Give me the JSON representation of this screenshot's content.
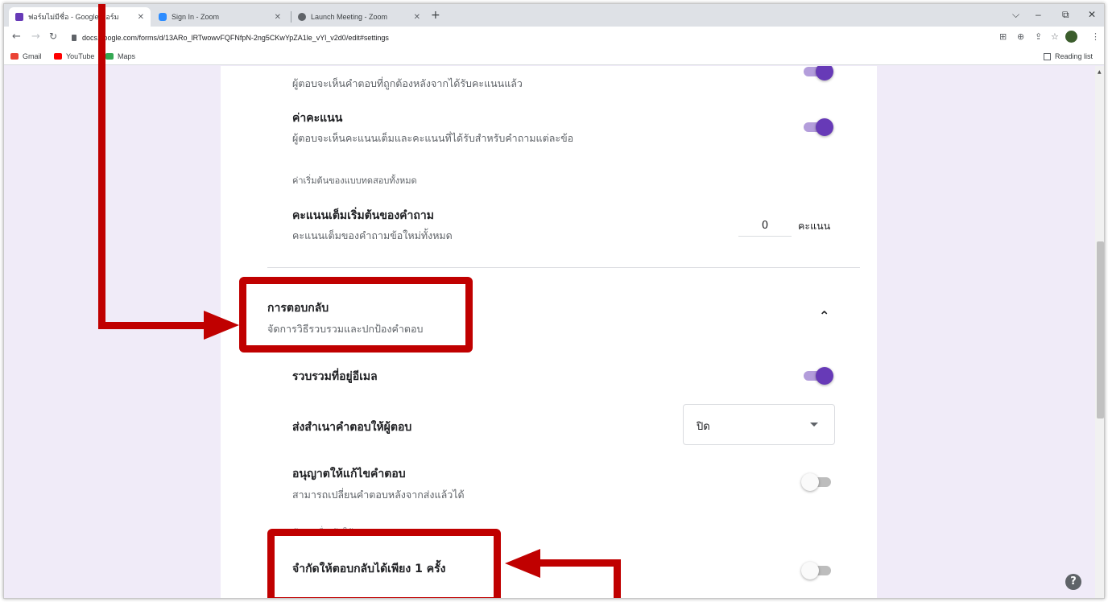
{
  "browser": {
    "tabs": [
      {
        "title": "ฟอร์มไม่มีชื่อ - Google ฟอร์ม",
        "fav_color": "#673ab7"
      },
      {
        "title": "Sign In - Zoom",
        "fav_color": "#2d8cff"
      },
      {
        "title": "Launch Meeting - Zoom",
        "fav_color": "#5f6368"
      }
    ],
    "new_tab": "+",
    "url": "docs.google.com/forms/d/13ARo_lRTwowvFQFNfpN-2ng5CKwYpZA1le_vYl_v2d0/edit#settings",
    "bookmarks": [
      "Gmail",
      "YouTube",
      "Maps"
    ],
    "reading_list": "Reading list",
    "window_controls": [
      "⌵",
      "–",
      "⧉",
      "✕"
    ]
  },
  "settings": {
    "show_answers_desc": "ผู้ตอบจะเห็นคำตอบที่ถูกต้องหลังจากได้รับคะแนนแล้ว",
    "point_values": {
      "title": "ค่าคะแนน",
      "desc": "ผู้ตอบจะเห็นคะแนนเต็มและคะแนนที่ได้รับสำหรับคำถามแต่ละข้อ",
      "enabled": true
    },
    "global_defaults_label": "ค่าเริ่มต้นของแบบทดสอบทั้งหมด",
    "default_points": {
      "title": "คะแนนเต็มเริ่มต้นของคำถาม",
      "desc": "คะแนนเต็มของคำถามข้อใหม่ทั้งหมด",
      "value": "0",
      "unit": "คะแนน"
    },
    "responses": {
      "title": "การตอบกลับ",
      "desc": "จัดการวิธีรวบรวมและปกป้องคำตอบ",
      "collect_email": {
        "title": "รวบรวมที่อยู่อีเมล",
        "enabled": true
      },
      "send_copy": {
        "title": "ส่งสำเนาคำตอบให้ผู้ตอบ",
        "value": "ปิด"
      },
      "allow_edit": {
        "title": "อนุญาตให้แก้ไขคำตอบ",
        "desc": "สามารถเปลี่ยนคำตอบหลังจากส่งแล้วได้",
        "enabled": false
      },
      "requires_signin_label": "ต้องลงชื่อเข้าใช้",
      "limit_one": {
        "title": "จำกัดให้ตอบกลับได้เพียง 1 ครั้ง",
        "enabled": false
      }
    }
  },
  "help": "?",
  "annotation_color": "#c00000"
}
